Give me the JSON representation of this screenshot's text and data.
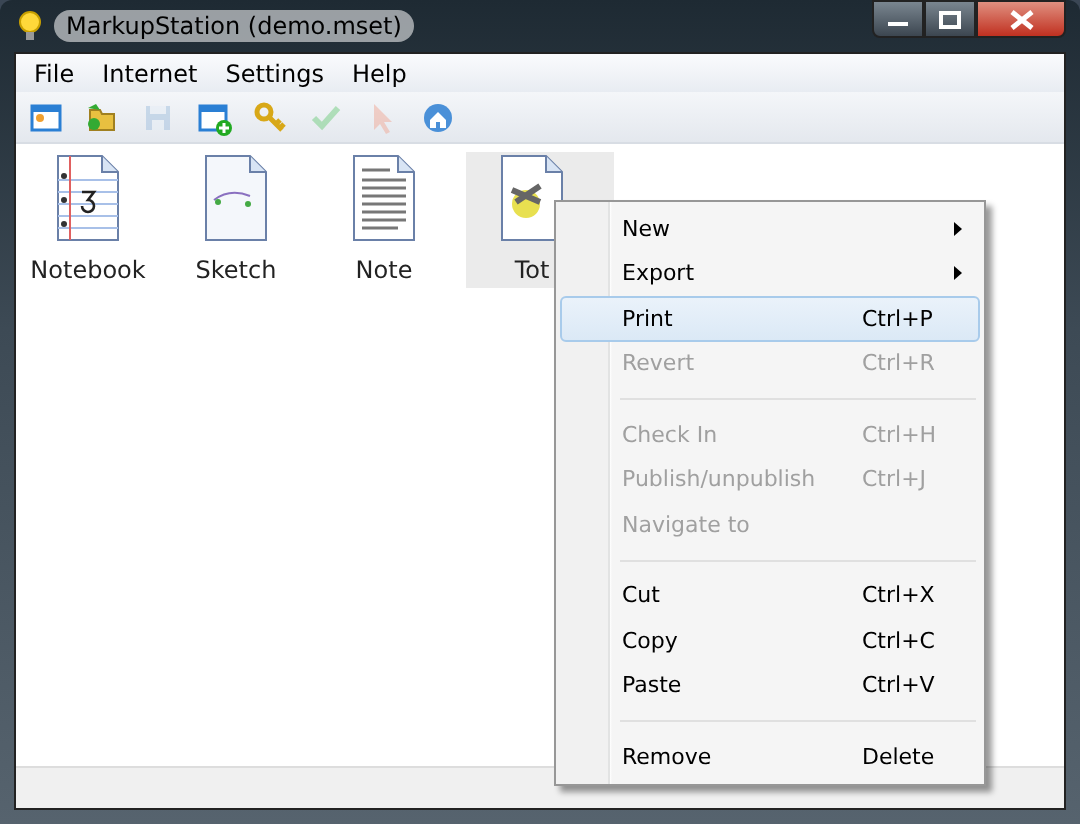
{
  "window": {
    "title": "MarkupStation (demo.mset)"
  },
  "menu_bar": [
    "File",
    "Internet",
    "Settings",
    "Help"
  ],
  "toolbar": [
    {
      "kind": "window",
      "disabled": false
    },
    {
      "kind": "folders",
      "disabled": false
    },
    {
      "kind": "save",
      "disabled": true
    },
    {
      "kind": "add",
      "disabled": false
    },
    {
      "kind": "key",
      "disabled": false
    },
    {
      "kind": "check",
      "disabled": true
    },
    {
      "kind": "pointer",
      "disabled": true
    },
    {
      "kind": "home",
      "disabled": false
    }
  ],
  "documents": [
    {
      "label": "Notebook",
      "kind": "notebook",
      "selected": false
    },
    {
      "label": "Sketch",
      "kind": "sketch",
      "selected": false
    },
    {
      "label": "Note",
      "kind": "note",
      "selected": false
    },
    {
      "label": "Tot",
      "kind": "tot",
      "selected": true
    }
  ],
  "context_menu": [
    {
      "kind": "item",
      "label": "New",
      "submenu": true,
      "disabled": false,
      "selected": false
    },
    {
      "kind": "item",
      "label": "Export",
      "submenu": true,
      "disabled": false,
      "selected": false
    },
    {
      "kind": "item",
      "label": "Print",
      "shortcut": "Ctrl+P",
      "disabled": false,
      "selected": true
    },
    {
      "kind": "item",
      "label": "Revert",
      "shortcut": "Ctrl+R",
      "disabled": true,
      "selected": false
    },
    {
      "kind": "separator"
    },
    {
      "kind": "item",
      "label": "Check In",
      "shortcut": "Ctrl+H",
      "disabled": true,
      "selected": false
    },
    {
      "kind": "item",
      "label": "Publish/unpublish",
      "shortcut": "Ctrl+J",
      "disabled": true,
      "selected": false
    },
    {
      "kind": "item",
      "label": "Navigate to",
      "disabled": true,
      "selected": false
    },
    {
      "kind": "separator"
    },
    {
      "kind": "item",
      "label": "Cut",
      "shortcut": "Ctrl+X",
      "disabled": false,
      "selected": false
    },
    {
      "kind": "item",
      "label": "Copy",
      "shortcut": "Ctrl+C",
      "disabled": false,
      "selected": false
    },
    {
      "kind": "item",
      "label": "Paste",
      "shortcut": "Ctrl+V",
      "disabled": false,
      "selected": false
    },
    {
      "kind": "separator"
    },
    {
      "kind": "item",
      "label": "Remove",
      "shortcut": "Delete",
      "disabled": false,
      "selected": false
    }
  ]
}
